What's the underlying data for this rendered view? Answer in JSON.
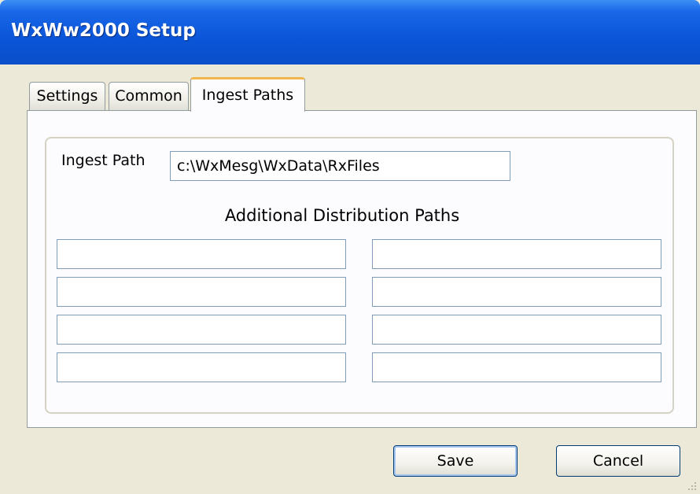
{
  "window": {
    "title": "WxWw2000 Setup"
  },
  "tabs": [
    {
      "label": "Settings"
    },
    {
      "label": "Common"
    },
    {
      "label": "Ingest Paths"
    }
  ],
  "active_tab": "Ingest Paths",
  "ingest": {
    "label": "Ingest Path",
    "value": "c:\\WxMesg\\WxData\\RxFiles"
  },
  "distribution": {
    "heading": "Additional Distribution Paths",
    "paths_left": [
      "",
      "",
      "",
      ""
    ],
    "paths_right": [
      "",
      "",
      "",
      ""
    ]
  },
  "buttons": {
    "save": "Save",
    "cancel": "Cancel"
  },
  "colors": {
    "title_bar": "#0a55d8",
    "active_tab_accent": "#f2b74c",
    "input_border": "#7f9db9"
  }
}
